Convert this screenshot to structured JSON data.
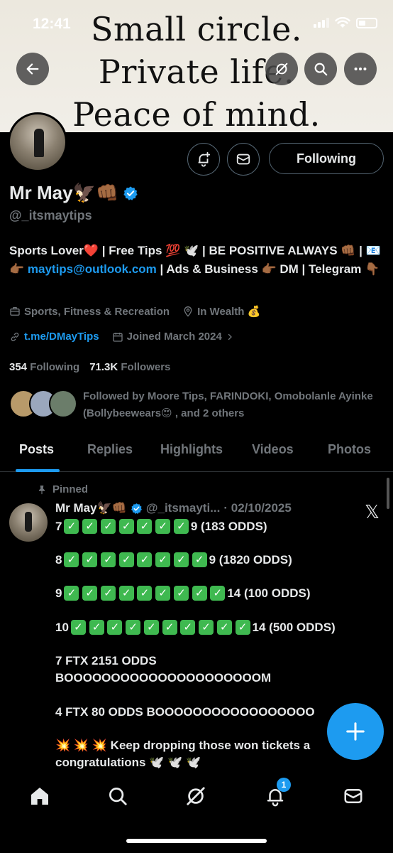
{
  "status_bar": {
    "time": "12:41"
  },
  "banner": {
    "line1": "Small circle.",
    "line2": "Private life.",
    "line3": "Peace of mind."
  },
  "profile": {
    "display_name": "Mr May🦅👊🏾",
    "handle": "@_itsmaytips",
    "following_button": "Following",
    "bio_part1": "Sports Lover❤️ | Free Tips 💯 🕊️ | BE POSITIVE ALWAYS 👊🏾 | 📧 👉🏾 ",
    "bio_email": "maytips@outlook.com",
    "bio_part2": " | Ads & Business 👉🏾 DM | Telegram 👇🏾",
    "category": "Sports, Fitness & Recreation",
    "location": "In Wealth 💰",
    "website": "t.me/DMayTips",
    "joined": "Joined March 2024",
    "following_count": "354",
    "following_label": "Following",
    "followers_count": "71.3K",
    "followers_label": "Followers",
    "followed_by": "Followed by Moore Tips, FARINDOKI, Omobolanle Ayinke (Bollybeewears😍 , and 2 others"
  },
  "tabs": [
    {
      "label": "Posts"
    },
    {
      "label": "Replies"
    },
    {
      "label": "Highlights"
    },
    {
      "label": "Videos"
    },
    {
      "label": "Photos"
    }
  ],
  "post": {
    "pinned_label": "Pinned",
    "author_name": "Mr May🦅👊🏾",
    "author_handle": "@_itsmayti...",
    "date": "· 02/10/2025",
    "line1_prefix": "7",
    "line1_suffix": "9 (183 ODDS)",
    "line2_prefix": "8",
    "line2_suffix": "9 (1820 ODDS)",
    "line3_prefix": "9",
    "line3_suffix": "14 (100 ODDS)",
    "line4_prefix": "10",
    "line4_suffix": "14 (500 ODDS)",
    "line5": "7 FTX 2151 ODDS",
    "line6": "BOOOOOOOOOOOOOOOOOOOOOM",
    "line7": "4 FTX 80 ODDS BOOOOOOOOOOOOOOOOO",
    "line8": "💥 💥 💥 Keep dropping those won tickets a",
    "line9": "congratulations 🕊️ 🕊️ 🕊️"
  },
  "nav": {
    "notifications_badge": "1"
  },
  "colors": {
    "accent": "#1d9bf0",
    "background": "#000000",
    "muted": "#71767b",
    "check": "#3fb950"
  }
}
